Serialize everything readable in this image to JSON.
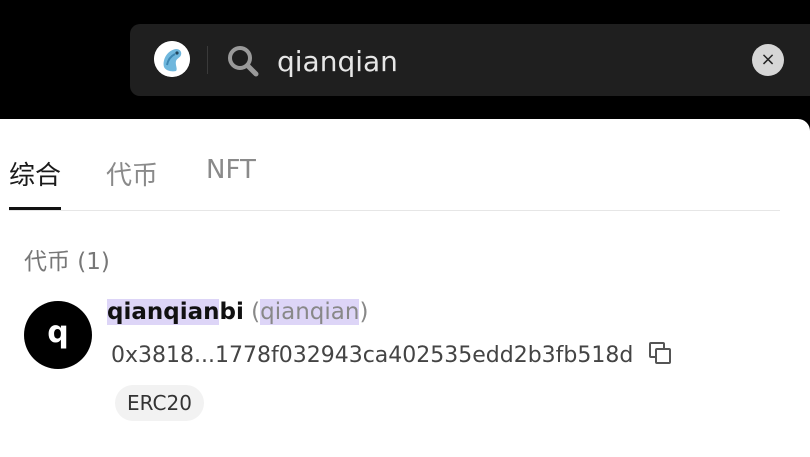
{
  "search": {
    "query": "qianqian",
    "clear_label": "×"
  },
  "tabs": [
    {
      "label": "综合"
    },
    {
      "label": "代币"
    },
    {
      "label": "NFT"
    }
  ],
  "results": {
    "section_title": "代币 (1)",
    "token": {
      "avatar_letter": "q",
      "name_highlight": "qianqian",
      "name_rest": "bi",
      "symbol": "qianqian",
      "paren_open": "(",
      "paren_close": ")",
      "address": "0x3818...1778f032943ca402535edd2b3fb518d",
      "chip": "ERC20"
    }
  },
  "colors": {
    "highlight": "#ddd5f7",
    "topbar": "#000000",
    "search_bg": "#1f1f1f"
  }
}
